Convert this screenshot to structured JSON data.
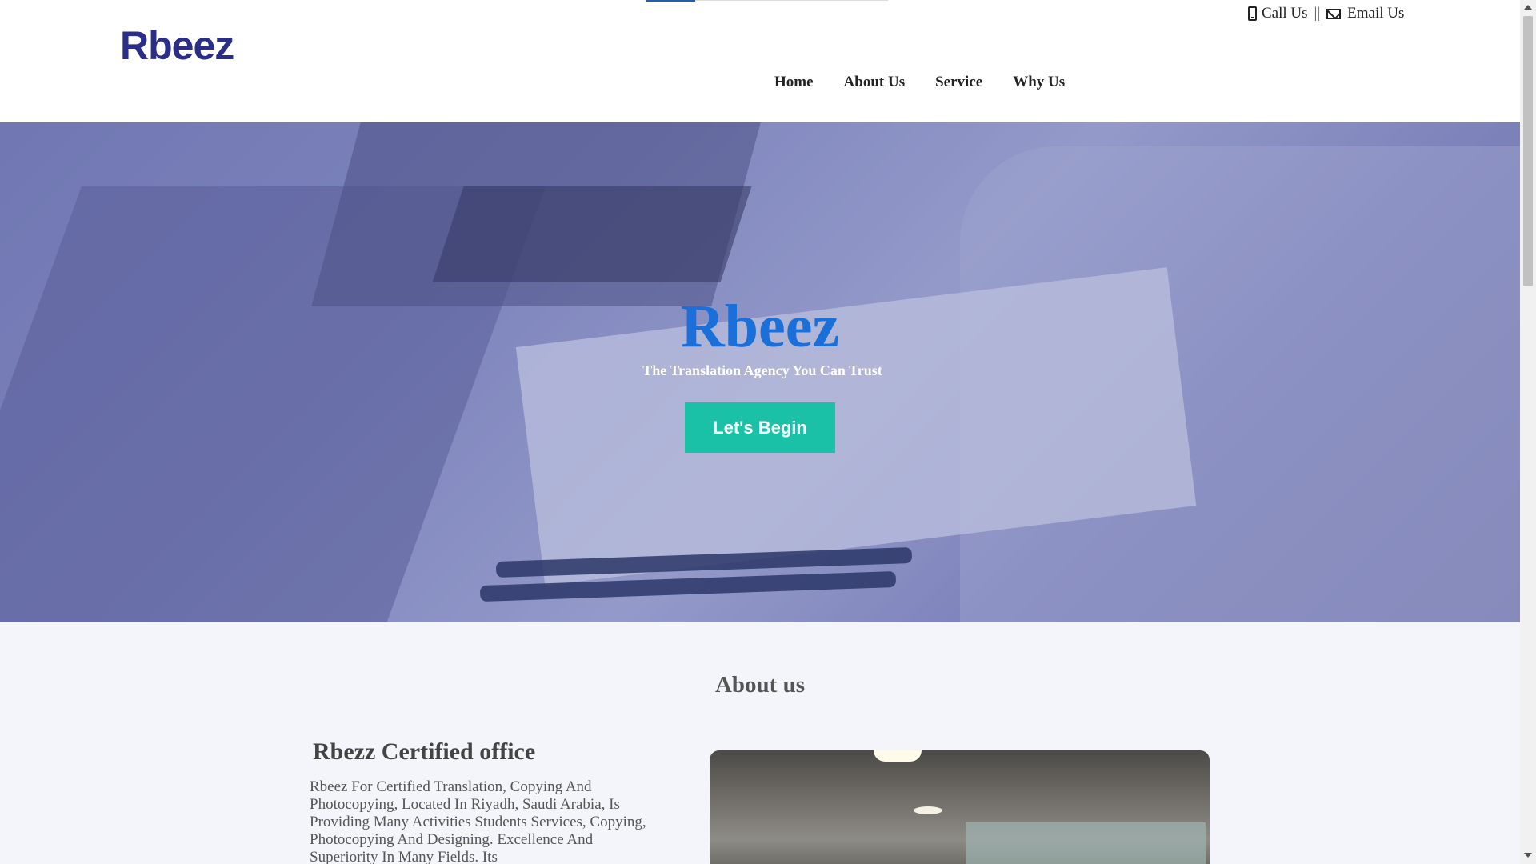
{
  "header": {
    "logo_text": "Rbeez",
    "contact": {
      "call_label": "Call Us",
      "separator": "||",
      "email_label": "Email Us"
    },
    "nav": [
      {
        "label": "Home"
      },
      {
        "label": "About Us"
      },
      {
        "label": "Service"
      },
      {
        "label": "Why Us"
      }
    ]
  },
  "hero": {
    "title": "Rbeez",
    "subtitle": "The Translation Agency You Can Trust",
    "cta_label": "Let's Begin"
  },
  "about": {
    "heading": "About us",
    "title": "Rbezz Certified office",
    "text": "Rbeez For Certified Translation, Copying And Photocopying, Located In Riyadh, Saudi Arabia, Is Providing Many Activities Students Services, Copying, Photocopying And Designing. Excellence And Superiority In Many Fields. Its"
  },
  "colors": {
    "logo": "#2b2e89",
    "hero_title": "#1a6fd8",
    "cta_bg": "#1bc1a6",
    "hero_tint": "#7a80b8"
  }
}
